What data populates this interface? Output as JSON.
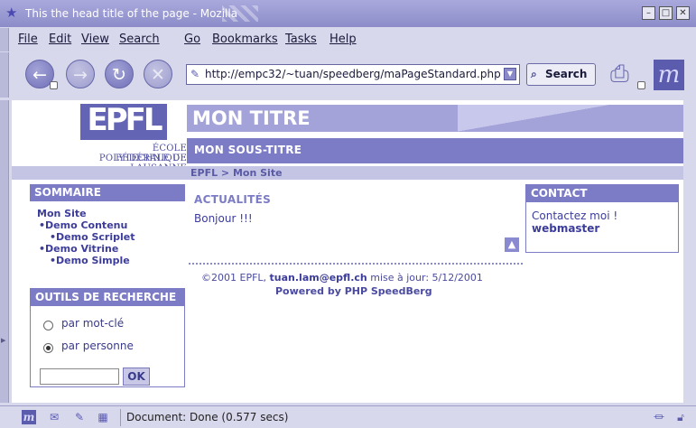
{
  "window": {
    "title": "This the head title of the page - Mozilla",
    "controls": [
      "minimize-icon",
      "maximize-icon",
      "close-icon"
    ]
  },
  "menu": [
    "File",
    "Edit",
    "View",
    "Search",
    "Go",
    "Bookmarks",
    "Tasks",
    "Help"
  ],
  "navigation": {
    "buttons": [
      "back-icon",
      "forward-icon",
      "reload-icon",
      "stop-icon"
    ],
    "url": "http://empc32/~tuan/speedberg/maPageStandard.php",
    "search_label": "Search"
  },
  "page": {
    "logo": "EPFL",
    "school_line1": "ÉCOLE POLYTECHNIQUE",
    "school_line2": "FÉDÉRALE DE LAUSANNE",
    "title": "MON TITRE",
    "subtitle": "MON SOUS-TITRE",
    "breadcrumb": "EPFL > Mon Site",
    "sommaire": {
      "heading": "SOMMAIRE",
      "items": [
        {
          "label": "Mon Site"
        },
        {
          "label": "•Demo Contenu"
        },
        {
          "label": "•Demo Scriplet"
        },
        {
          "label": "•Demo Vitrine"
        },
        {
          "label": "•Demo Simple"
        }
      ]
    },
    "outils": {
      "heading": "OUTILS DE RECHERCHE",
      "options": [
        {
          "label": "par mot-clé",
          "checked": false
        },
        {
          "label": "par personne",
          "checked": true
        }
      ],
      "input_value": "",
      "ok_label": "OK"
    },
    "actualites": {
      "heading": "ACTUALITÉS",
      "text": "Bonjour !!!"
    },
    "contact": {
      "heading": "CONTACT",
      "text": "Contactez moi !",
      "link": "webmaster"
    },
    "footer": {
      "copyright": "©2001 EPFL,",
      "email": "tuan.lam@epfl.ch",
      "updated": "mise à jour: 5/12/2001",
      "powered": "Powered by PHP SpeedBerg"
    }
  },
  "status": {
    "icons": [
      "mozilla-icon",
      "mail-icon",
      "composer-icon",
      "address-book-icon"
    ],
    "text": "Document: Done (0.577 secs)"
  },
  "colors": {
    "accent": "#7c7cc6",
    "banner": "#a3a3d9",
    "chrome": "#d8d8ec"
  }
}
